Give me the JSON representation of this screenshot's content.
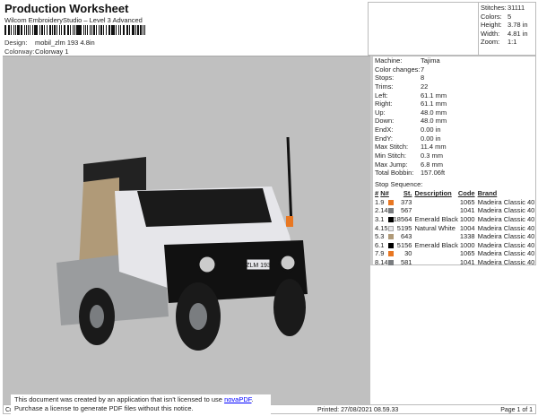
{
  "header": {
    "title": "Production Worksheet",
    "subtitle": "Wilcom EmbroideryStudio – Level 3 Advanced",
    "design_label": "Design:",
    "design_value": "mobil_zlm 193 4.8in",
    "colorway_label": "Colorway:",
    "colorway_value": "Colorway 1"
  },
  "stats": [
    {
      "k": "Stitches:",
      "v": "31111"
    },
    {
      "k": "Colors:",
      "v": "5"
    },
    {
      "k": "Height:",
      "v": "3.78 in"
    },
    {
      "k": "Width:",
      "v": "4.81 in"
    },
    {
      "k": "Zoom:",
      "v": "1:1"
    }
  ],
  "info": [
    {
      "k": "Machine:",
      "v": "Tajima"
    },
    {
      "k": "Color changes:",
      "v": "7"
    },
    {
      "k": "Stops:",
      "v": "8"
    },
    {
      "k": "Trims:",
      "v": "22"
    },
    {
      "k": "Left:",
      "v": "61.1 mm"
    },
    {
      "k": "Right:",
      "v": "61.1 mm"
    },
    {
      "k": "Up:",
      "v": "48.0 mm"
    },
    {
      "k": "Down:",
      "v": "48.0 mm"
    },
    {
      "k": "EndX:",
      "v": "0.00 in"
    },
    {
      "k": "EndY:",
      "v": "0.00 in"
    },
    {
      "k": "Max Stitch:",
      "v": "11.4 mm"
    },
    {
      "k": "Min Stitch:",
      "v": "0.3 mm"
    },
    {
      "k": "Max Jump:",
      "v": "6.8 mm"
    },
    {
      "k": "Total Bobbin:",
      "v": "157.06ft"
    }
  ],
  "sequence": {
    "title": "Stop Sequence:",
    "headers": [
      "#",
      "N#",
      "St.",
      "Description",
      "Code",
      "Brand"
    ],
    "rows": [
      {
        "n": "1.",
        "needle": "9",
        "color": "#e87722",
        "st": "373",
        "desc": "",
        "code": "1065",
        "brand": "Madeira Classic 40"
      },
      {
        "n": "2.",
        "needle": "14",
        "color": "#7a7d80",
        "st": "567",
        "desc": "",
        "code": "1041",
        "brand": "Madeira Classic 40"
      },
      {
        "n": "3.",
        "needle": "1",
        "color": "#000000",
        "st": "18564",
        "desc": "Emerald Black",
        "code": "1000",
        "brand": "Madeira Classic 40"
      },
      {
        "n": "4.",
        "needle": "15",
        "color": "#e6e6ea",
        "st": "5195",
        "desc": "Natural White",
        "code": "1004",
        "brand": "Madeira Classic 40"
      },
      {
        "n": "5.",
        "needle": "3",
        "color": "#b09a78",
        "st": "643",
        "desc": "",
        "code": "1338",
        "brand": "Madeira Classic 40"
      },
      {
        "n": "6.",
        "needle": "1",
        "color": "#000000",
        "st": "5156",
        "desc": "Emerald Black",
        "code": "1000",
        "brand": "Madeira Classic 40"
      },
      {
        "n": "7.",
        "needle": "9",
        "color": "#e87722",
        "st": "30",
        "desc": "",
        "code": "1065",
        "brand": "Madeira Classic 40"
      },
      {
        "n": "8.",
        "needle": "14",
        "color": "#7a7d80",
        "st": "581",
        "desc": "",
        "code": "1041",
        "brand": "Madeira Classic 40"
      }
    ]
  },
  "design": {
    "plate": "ZLM 193"
  },
  "notice": {
    "line1": "This document was created by an application that isn't licensed to use ",
    "link": "novaPDF",
    "line1_end": ".",
    "line2": "Purchase a license to generate PDF files without this notice."
  },
  "footer": {
    "left": "Cr",
    "printed": "Printed: 27/08/2021 08.59.33",
    "page": "Page 1 of 1"
  }
}
